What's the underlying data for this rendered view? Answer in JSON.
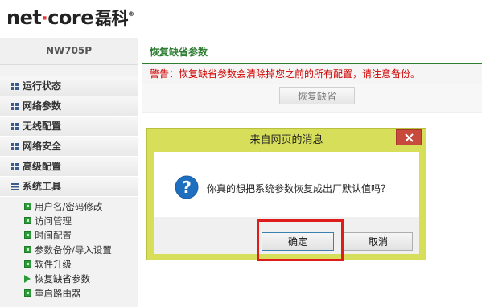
{
  "header": {
    "logo_prefix": "net",
    "logo_dot": "·",
    "logo_suffix": "core",
    "logo_cn": "磊科",
    "logo_reg": "®"
  },
  "sidebar": {
    "model": "NW705P",
    "menu": [
      {
        "label": "运行状态",
        "icon": "grid-icon"
      },
      {
        "label": "网络参数",
        "icon": "grid-icon"
      },
      {
        "label": "无线配置",
        "icon": "grid-icon"
      },
      {
        "label": "网络安全",
        "icon": "grid-icon"
      },
      {
        "label": "高级配置",
        "icon": "grid-icon"
      },
      {
        "label": "系统工具",
        "icon": "list-icon"
      }
    ],
    "submenu": [
      {
        "label": "用户名/密码修改"
      },
      {
        "label": "访问管理"
      },
      {
        "label": "时间配置"
      },
      {
        "label": "参数备份/导入设置"
      },
      {
        "label": "软件升级"
      },
      {
        "label": "恢复缺省参数",
        "active": true
      },
      {
        "label": "重启路由器"
      }
    ]
  },
  "main": {
    "section_title": "恢复缺省参数",
    "warning": "警告：恢复缺省参数会清除掉您之前的所有配置，请注意备份。",
    "restore_button": "恢复缺省"
  },
  "dialog": {
    "title": "来自网页的消息",
    "message": "你真的想把系统参数恢复成出厂默认值吗？",
    "ok_label": "确定",
    "cancel_label": "取消"
  },
  "colors": {
    "accent_green": "#2e7d32",
    "warning_red": "#d10000",
    "dialog_frame": "#d7de5a",
    "close_red": "#c74a3d",
    "highlight_red": "#e01b1b"
  }
}
